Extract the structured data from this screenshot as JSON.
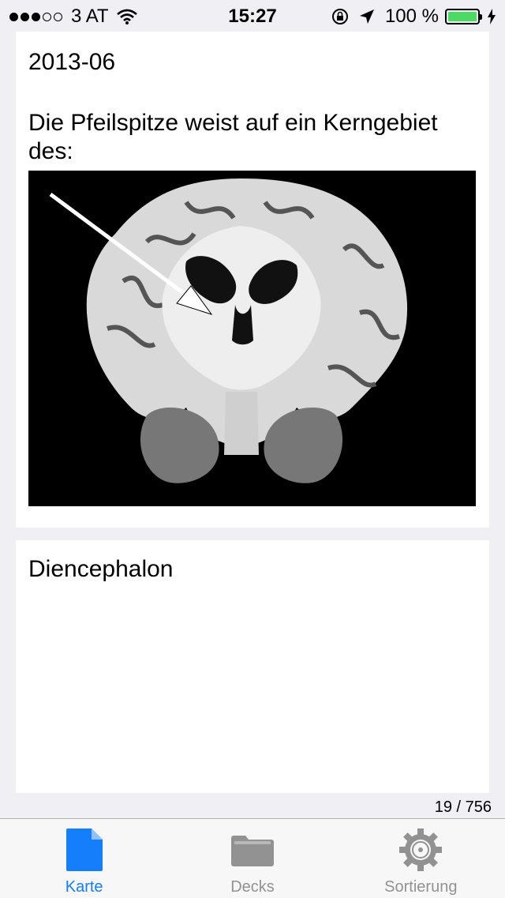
{
  "status_bar": {
    "carrier": "3 AT",
    "time": "15:27",
    "battery_percent": "100 %",
    "signal_bars_filled": 3,
    "signal_bars_total": 5
  },
  "card": {
    "deck_name": "2013-06",
    "question": "Die Pfeilspitze weist auf ein Kerngebiet des:",
    "answer": "Diencephalon"
  },
  "counter": "19 / 756",
  "tabs": [
    {
      "label": "Karte",
      "icon": "document-icon",
      "active": true
    },
    {
      "label": "Decks",
      "icon": "folder-icon",
      "active": false
    },
    {
      "label": "Sortierung",
      "icon": "gear-icon",
      "active": false
    }
  ],
  "colors": {
    "accent": "#147efb",
    "inactive": "#929292",
    "battery": "#4cd964",
    "background": "#efeff4"
  }
}
